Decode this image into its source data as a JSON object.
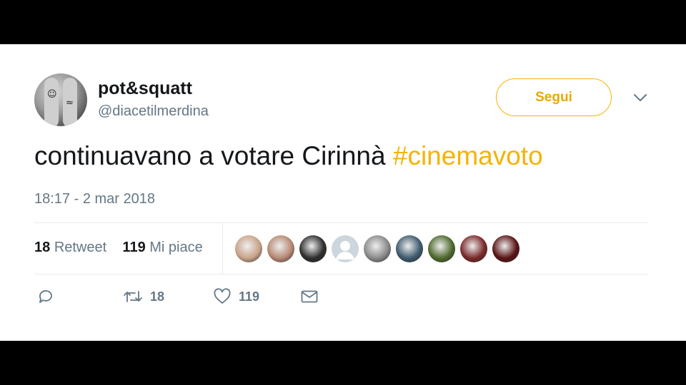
{
  "tweet": {
    "user": {
      "name": "pot&squatt",
      "handle": "@diacetilmerdina"
    },
    "follow_label": "Segui",
    "text": "continuavano a votare Cirinnà ",
    "hashtag": "#cinemavoto",
    "timestamp": "18:17 - 2 mar 2018",
    "stats": {
      "retweets_count": "18",
      "retweets_label": "Retweet",
      "likes_count": "119",
      "likes_label": "Mi piace"
    },
    "likers": [
      {
        "icon": "liker-avatar-1",
        "color": "#c9a38a"
      },
      {
        "icon": "liker-avatar-2",
        "color": "#b78974"
      },
      {
        "icon": "liker-avatar-3",
        "color": "#2f2f2f"
      },
      {
        "icon": "default-avatar",
        "color": "#ccd6dd"
      },
      {
        "icon": "liker-avatar-5",
        "color": "#8a8a8a"
      },
      {
        "icon": "liker-avatar-6",
        "color": "#3e5a6e"
      },
      {
        "icon": "liker-avatar-7",
        "color": "#4f6a2e"
      },
      {
        "icon": "liker-avatar-8",
        "color": "#7a2a2a"
      },
      {
        "icon": "liker-avatar-9",
        "color": "#5a1414"
      }
    ],
    "actions": {
      "reply_count": "",
      "retweet_count": "18",
      "like_count": "119"
    },
    "colors": {
      "accent": "#f4b400",
      "text": "#14171a",
      "secondary": "#657786"
    }
  }
}
